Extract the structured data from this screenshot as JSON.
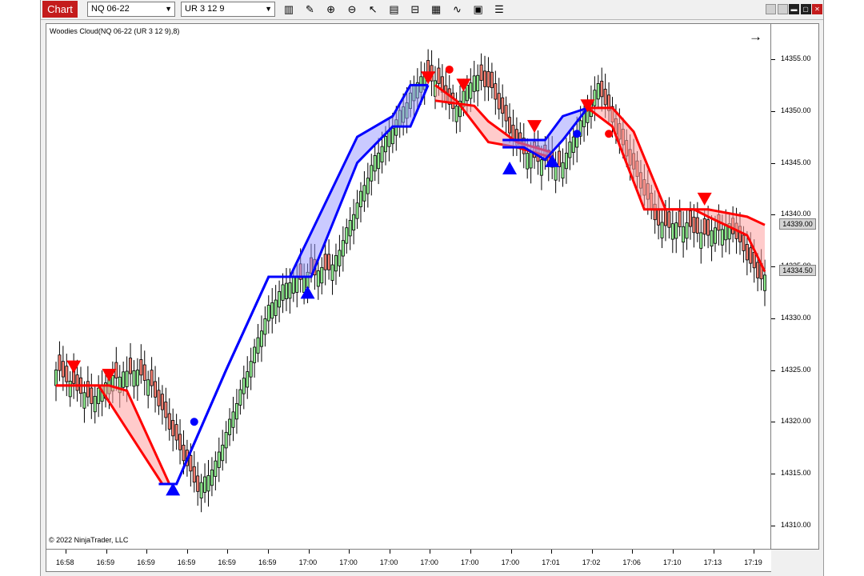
{
  "toolbar": {
    "chart_tab": "Chart",
    "instrument": "NQ 06-22",
    "bar_type": "UR 3 12 9",
    "tool_icons": [
      "bar-style-icon",
      "draw-icon",
      "zoom-in-icon",
      "zoom-out-icon",
      "pointer-icon",
      "data-box-icon",
      "chart-trader-icon",
      "indicators-icon",
      "strategies-icon",
      "properties-icon",
      "templates-icon"
    ]
  },
  "window_buttons": [
    "tile-icon",
    "restore-icon",
    "minimize-icon",
    "maximize-icon",
    "close-icon"
  ],
  "chart": {
    "indicator_label": "Woodies Cloud(NQ 06-22 (UR 3 12 9),8)",
    "copyright": "© 2022 NinjaTrader, LLC",
    "price_markers": [
      {
        "label": "14339.00",
        "value": 14339.0
      },
      {
        "label": "14334.50",
        "value": 14334.5
      }
    ],
    "colors": {
      "up_bar": "#90ee90",
      "down_bar": "#fa8072",
      "bull_cloud": "#0000ff",
      "bear_cloud": "#ff0000",
      "bull_fill": "#c8c8ff",
      "bear_fill": "#ffc8c8"
    }
  },
  "chart_data": {
    "type": "candlestick",
    "ylim": [
      14307.5,
      14358.5
    ],
    "y_ticks": [
      "14355.00",
      "14350.00",
      "14345.00",
      "14340.00",
      "14335.00",
      "14330.00",
      "14325.00",
      "14320.00",
      "14315.00",
      "14310.00"
    ],
    "y_tick_values": [
      14355,
      14350,
      14345,
      14340,
      14335,
      14330,
      14325,
      14320,
      14315,
      14310
    ],
    "x_ticks": [
      "16:58",
      "16:59",
      "16:59",
      "16:59",
      "16:59",
      "16:59",
      "17:00",
      "17:00",
      "17:00",
      "17:00",
      "17:00",
      "17:00",
      "17:01",
      "17:02",
      "17:06",
      "17:10",
      "17:13",
      "17:19"
    ],
    "close_path": [
      [
        0,
        14325
      ],
      [
        10,
        14322
      ],
      [
        14,
        14324
      ],
      [
        22,
        14325
      ],
      [
        26,
        14324
      ],
      [
        40,
        14313.5
      ],
      [
        45,
        14316
      ],
      [
        60,
        14331
      ],
      [
        65,
        14333.5
      ],
      [
        78,
        14335
      ],
      [
        90,
        14345.5
      ],
      [
        103,
        14353.5
      ],
      [
        107,
        14353
      ],
      [
        112,
        14350
      ],
      [
        118,
        14353.5
      ],
      [
        123,
        14352
      ],
      [
        130,
        14346.5
      ],
      [
        138,
        14345
      ],
      [
        142,
        14344.5
      ],
      [
        150,
        14350.5
      ],
      [
        153,
        14352.5
      ],
      [
        158,
        14348
      ],
      [
        170,
        14339
      ],
      [
        178,
        14339
      ],
      [
        182,
        14338
      ],
      [
        190,
        14339
      ],
      [
        198,
        14334
      ]
    ],
    "bull_upper": [
      [
        29,
        14314
      ],
      [
        34,
        14314
      ],
      [
        48,
        14325
      ],
      [
        60,
        14334
      ],
      [
        66,
        14334
      ],
      [
        85,
        14347.5
      ],
      [
        95,
        14349.5
      ],
      [
        100,
        14352.5
      ],
      [
        105,
        14352.5
      ]
    ],
    "bull_lower": [
      [
        29,
        14314
      ],
      [
        34,
        14314
      ],
      [
        48,
        14325
      ],
      [
        60,
        14334
      ],
      [
        66,
        14334
      ],
      [
        72,
        14334
      ],
      [
        85,
        14345
      ],
      [
        95,
        14348.5
      ],
      [
        100,
        14348.5
      ],
      [
        105,
        14352.5
      ]
    ],
    "bear_upper": [
      [
        0,
        14323.5
      ],
      [
        15,
        14323.5
      ],
      [
        20,
        14323
      ],
      [
        32,
        14314
      ],
      [
        34,
        14314
      ]
    ],
    "bear_lower": [
      [
        0,
        14323.5
      ],
      [
        12,
        14323.5
      ],
      [
        30,
        14314
      ],
      [
        34,
        14314
      ]
    ],
    "bear2_upper": [
      [
        107,
        14351
      ],
      [
        118,
        14350.5
      ],
      [
        122,
        14349
      ],
      [
        130,
        14347
      ],
      [
        140,
        14346
      ]
    ],
    "bear2_lower": [
      [
        107,
        14352.5
      ],
      [
        113,
        14351
      ],
      [
        122,
        14347
      ],
      [
        130,
        14346.5
      ],
      [
        140,
        14345.5
      ]
    ],
    "bull2_upper": [
      [
        126,
        14347.2
      ],
      [
        138,
        14347.2
      ],
      [
        143,
        14349.5
      ],
      [
        150,
        14350.3
      ]
    ],
    "bull2_lower": [
      [
        126,
        14346.5
      ],
      [
        132,
        14346.5
      ],
      [
        138,
        14345.3
      ],
      [
        143,
        14347.2
      ],
      [
        150,
        14350.3
      ]
    ],
    "bear3_upper": [
      [
        150,
        14350.3
      ],
      [
        157,
        14350.3
      ],
      [
        163,
        14348
      ],
      [
        172,
        14340.5
      ],
      [
        184,
        14340.5
      ],
      [
        195,
        14339.8
      ],
      [
        200,
        14339
      ]
    ],
    "bear3_lower": [
      [
        150,
        14350.3
      ],
      [
        157,
        14348.5
      ],
      [
        166,
        14340.5
      ],
      [
        180,
        14340.5
      ],
      [
        184,
        14339.8
      ],
      [
        195,
        14338
      ],
      [
        200,
        14334.5
      ]
    ],
    "markers": [
      {
        "type": "down-triangle",
        "bar": 5,
        "price": 14325.3
      },
      {
        "type": "down-triangle",
        "bar": 15,
        "price": 14324.5
      },
      {
        "type": "up-triangle",
        "bar": 33,
        "price": 14313.5
      },
      {
        "type": "dot",
        "bar": 39,
        "price": 14320.0,
        "color": "bull"
      },
      {
        "type": "up-triangle",
        "bar": 71,
        "price": 14332.5
      },
      {
        "type": "down-triangle",
        "bar": 105,
        "price": 14353.2
      },
      {
        "type": "dot",
        "bar": 111,
        "price": 14354.0,
        "color": "bear"
      },
      {
        "type": "down-triangle",
        "bar": 115,
        "price": 14352.5
      },
      {
        "type": "up-triangle",
        "bar": 128,
        "price": 14344.5
      },
      {
        "type": "down-triangle",
        "bar": 135,
        "price": 14348.5
      },
      {
        "type": "up-triangle",
        "bar": 140,
        "price": 14345.2
      },
      {
        "type": "dot",
        "bar": 147,
        "price": 14347.8,
        "color": "bull"
      },
      {
        "type": "down-triangle",
        "bar": 150,
        "price": 14350.5
      },
      {
        "type": "dot",
        "bar": 156,
        "price": 14347.8,
        "color": "bear"
      },
      {
        "type": "down-triangle",
        "bar": 183,
        "price": 14341.5
      }
    ]
  }
}
